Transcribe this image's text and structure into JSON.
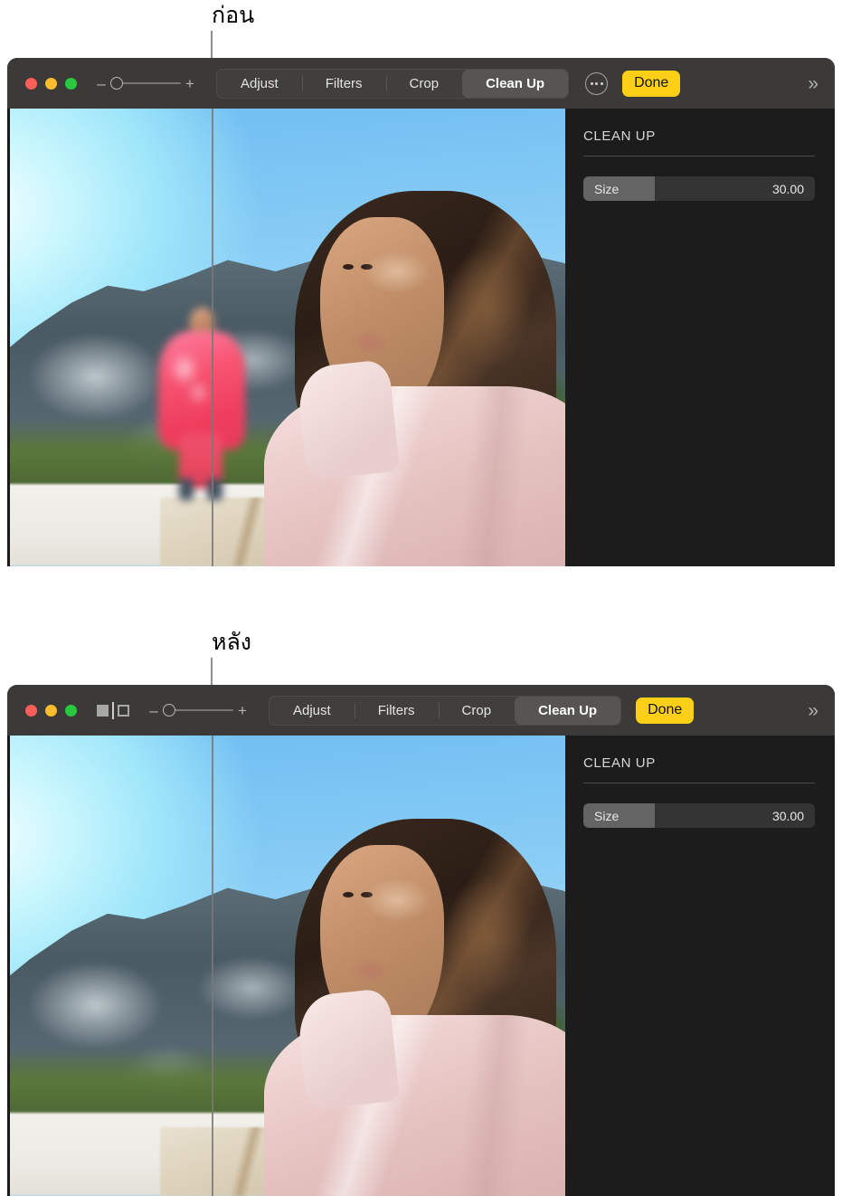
{
  "annotations": {
    "before": {
      "label": "ก่อน"
    },
    "after": {
      "label": "หลัง"
    }
  },
  "windows": [
    {
      "id": "before",
      "toolbar": {
        "traffic_lights": [
          {
            "name": "close",
            "color": "#fc5f57"
          },
          {
            "name": "minimize",
            "color": "#fdbc2e"
          },
          {
            "name": "maximize",
            "color": "#29c840"
          }
        ],
        "has_compare_toggle": false,
        "zoom_out_label": "–",
        "zoom_in_label": "+",
        "tabs": [
          {
            "label": "Adjust",
            "selected": false
          },
          {
            "label": "Filters",
            "selected": false
          },
          {
            "label": "Crop",
            "selected": false
          },
          {
            "label": "Clean Up",
            "selected": true
          }
        ],
        "has_more_button": true,
        "more_label": "more-options",
        "done_label": "Done",
        "done_color": "#fdd017",
        "chevron_label": "»"
      },
      "inspector": {
        "title": "CLEAN UP",
        "parameters": [
          {
            "label": "Size",
            "value": "30.00",
            "fill_percent": 31
          }
        ]
      },
      "photo": {
        "has_background_person": true
      }
    },
    {
      "id": "after",
      "toolbar": {
        "traffic_lights": [
          {
            "name": "close",
            "color": "#fc5f57"
          },
          {
            "name": "minimize",
            "color": "#fdbc2e"
          },
          {
            "name": "maximize",
            "color": "#29c840"
          }
        ],
        "has_compare_toggle": true,
        "compare_label": "compare-split-view",
        "zoom_out_label": "–",
        "zoom_in_label": "+",
        "tabs": [
          {
            "label": "Adjust",
            "selected": false
          },
          {
            "label": "Filters",
            "selected": false
          },
          {
            "label": "Crop",
            "selected": false
          },
          {
            "label": "Clean Up",
            "selected": true
          }
        ],
        "has_more_button": false,
        "done_label": "Done",
        "done_color": "#fdd017",
        "chevron_label": "»"
      },
      "inspector": {
        "title": "CLEAN UP",
        "parameters": [
          {
            "label": "Size",
            "value": "30.00",
            "fill_percent": 31
          }
        ]
      },
      "photo": {
        "has_background_person": false
      }
    }
  ]
}
